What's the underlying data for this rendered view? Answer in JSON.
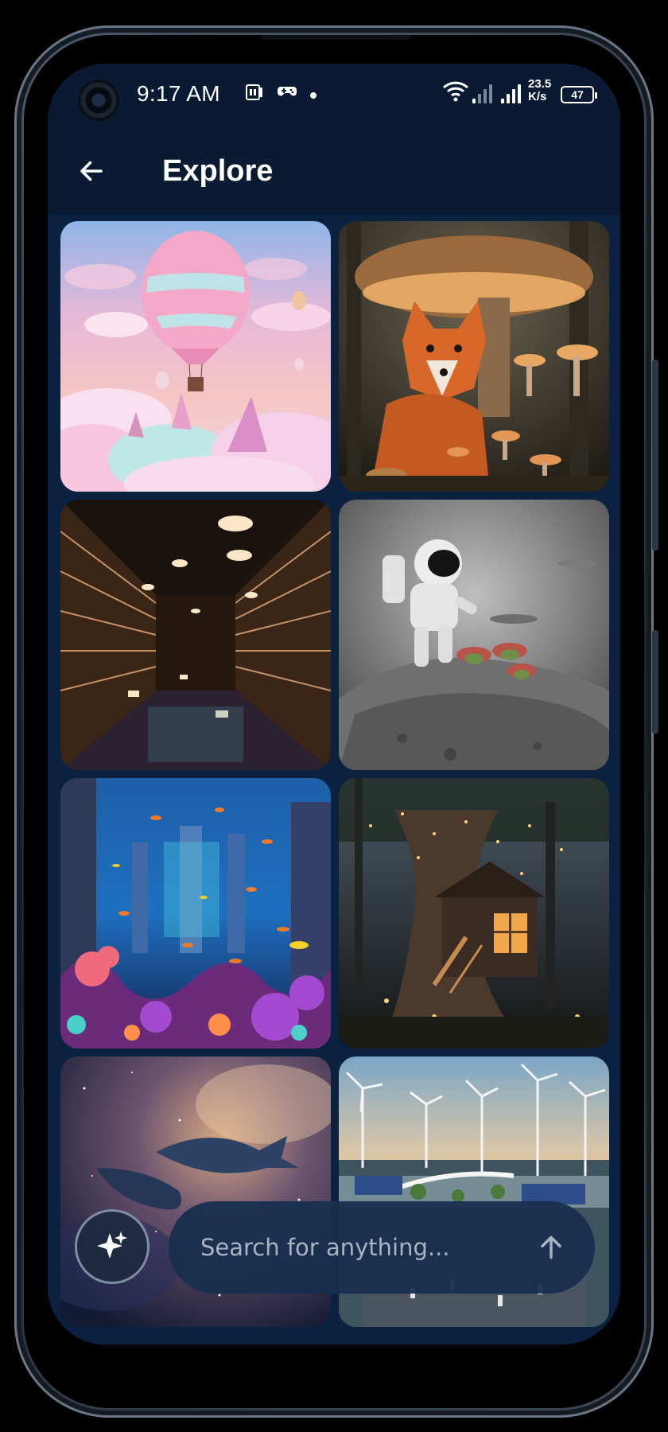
{
  "status_bar": {
    "time": "9:17 AM",
    "net_speed_value": "23.5",
    "net_speed_unit": "K/s",
    "battery": "47"
  },
  "header": {
    "title": "Explore",
    "back_icon": "arrow-left-icon"
  },
  "gallery": {
    "items": [
      {
        "name": "hot-air-balloon-clouds"
      },
      {
        "name": "fox-mushroom-forest"
      },
      {
        "name": "glowing-library"
      },
      {
        "name": "astronaut-succulents"
      },
      {
        "name": "underwater-coral-city"
      },
      {
        "name": "treehouse-night"
      },
      {
        "name": "space-whales-nebula"
      },
      {
        "name": "wind-turbine-city"
      }
    ]
  },
  "bottom_bar": {
    "sparkle_icon": "sparkle-icon",
    "search_placeholder": "Search for anything...",
    "send_icon": "arrow-up-icon"
  },
  "colors": {
    "background": "#0a1a33",
    "grid_background": "#0b2140",
    "search_background": "#182e4e",
    "text": "#ffffff"
  }
}
